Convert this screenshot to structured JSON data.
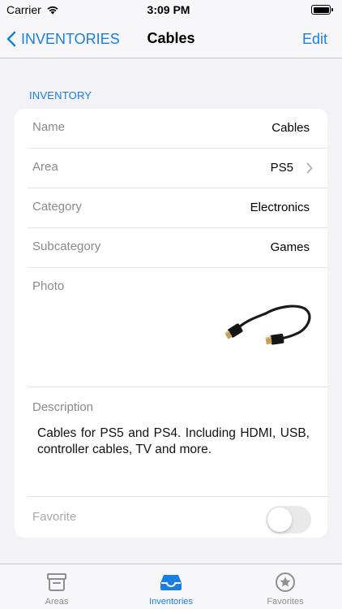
{
  "status_bar": {
    "carrier": "Carrier",
    "time": "3:09 PM"
  },
  "nav": {
    "back_label": "INVENTORIES",
    "title": "Cables",
    "edit_label": "Edit"
  },
  "section": {
    "header": "INVENTORY"
  },
  "fields": {
    "name": {
      "label": "Name",
      "value": "Cables"
    },
    "area": {
      "label": "Area",
      "value": "PS5"
    },
    "category": {
      "label": "Category",
      "value": "Electronics"
    },
    "subcategory": {
      "label": "Subcategory",
      "value": "Games"
    },
    "photo": {
      "label": "Photo",
      "image": "hdmi-cable-photo"
    },
    "description": {
      "label": "Description",
      "value": "Cables for PS5 and PS4. Including HDMI, USB, controller cables, TV and more."
    },
    "favorite": {
      "label": "Favorite",
      "on": false
    }
  },
  "tabs": [
    {
      "label": "Areas",
      "icon": "archive-box-icon",
      "active": false
    },
    {
      "label": "Inventories",
      "icon": "tray-icon",
      "active": true
    },
    {
      "label": "Favorites",
      "icon": "star-circle-icon",
      "active": false
    }
  ],
  "colors": {
    "accent": "#1a7fe0",
    "background": "#f2f2f7",
    "inactive": "#8e8e93"
  }
}
